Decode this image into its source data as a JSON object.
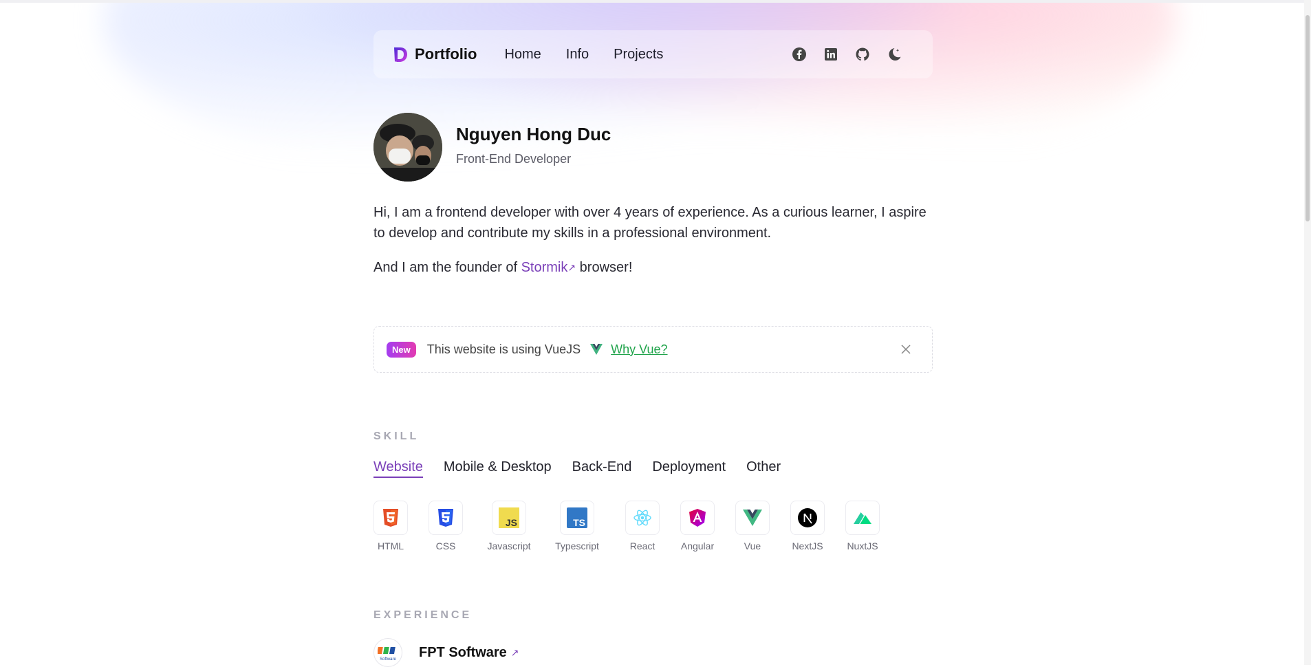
{
  "nav": {
    "brand": "Portfolio",
    "links": [
      "Home",
      "Info",
      "Projects"
    ],
    "icons": [
      "facebook-icon",
      "linkedin-icon",
      "github-icon",
      "moon-icon"
    ]
  },
  "profile": {
    "name": "Nguyen Hong Duc",
    "role": "Front-End Developer"
  },
  "bio": {
    "paragraph1": "Hi, I am a frontend developer with over 4 years of experience. As a curious learner, I aspire to develop and contribute my skills in a professional environment.",
    "paragraph2_prefix": "And I am the founder of ",
    "paragraph2_link": "Stormik",
    "paragraph2_suffix": " browser!"
  },
  "banner": {
    "badge": "New",
    "text": "This website is using VueJS",
    "link": "Why Vue?"
  },
  "skill": {
    "label": "SKILL",
    "tabs": [
      "Website",
      "Mobile & Desktop",
      "Back-End",
      "Deployment",
      "Other"
    ],
    "active_tab": "Website",
    "items": [
      "HTML",
      "CSS",
      "Javascript",
      "Typescript",
      "React",
      "Angular",
      "Vue",
      "NextJS",
      "NuxtJS"
    ]
  },
  "experience": {
    "label": "EXPERIENCE",
    "company": "FPT Software",
    "logo_text": "Software"
  },
  "colors": {
    "accent": "#7a3fb8",
    "vue_green": "#1fa34a"
  }
}
